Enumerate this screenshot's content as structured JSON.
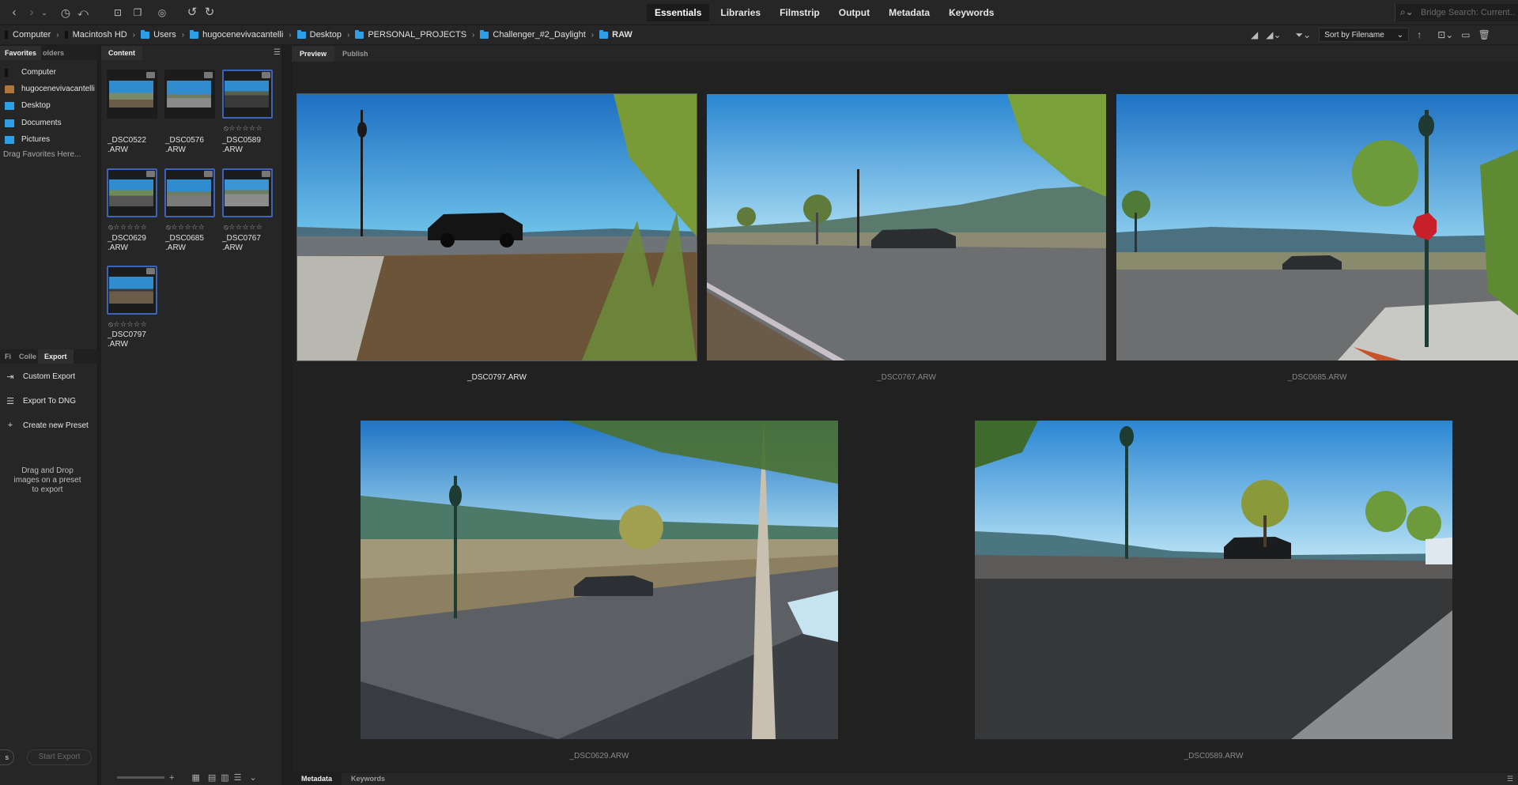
{
  "toolbar": {
    "workspaces": [
      "Essentials",
      "Libraries",
      "Filmstrip",
      "Output",
      "Metadata",
      "Keywords"
    ],
    "active_workspace": "Essentials",
    "search_placeholder": "Bridge Search: Current..."
  },
  "path": [
    "Computer",
    "Macintosh HD",
    "Users",
    "hugocenevivacantelli",
    "Desktop",
    "PERSONAL_PROJECTS",
    "Challenger_#2_Daylight",
    "RAW"
  ],
  "sort_label": "Sort by Filename",
  "left_panel": {
    "tabs": [
      "Favorites",
      "olders"
    ],
    "favorites": [
      {
        "label": "Computer",
        "icon": "drive-icon"
      },
      {
        "label": "hugocenevivacantelli",
        "icon": "home-icon"
      },
      {
        "label": "Desktop",
        "icon": "folder-icon"
      },
      {
        "label": "Documents",
        "icon": "folder-icon"
      },
      {
        "label": "Pictures",
        "icon": "folder-icon"
      }
    ],
    "drag_hint": "Drag Favorites Here...",
    "export_tabs": [
      "Fi",
      "Colle",
      "Export"
    ],
    "export_items": [
      {
        "label": "Custom Export",
        "icon": "export-icon"
      },
      {
        "label": "Export To DNG",
        "icon": "list-icon"
      },
      {
        "label": "Create new Preset",
        "icon": "plus-icon"
      }
    ],
    "drop_hint": "Drag and Drop images on a preset to export",
    "left_button": "s",
    "start_export": "Start Export"
  },
  "content_panel": {
    "tab": "Content",
    "thumbnails": [
      {
        "name": "_DSC0522",
        "ext": ".ARW",
        "rating": "",
        "selected": false
      },
      {
        "name": "_DSC0576",
        "ext": ".ARW",
        "rating": "",
        "selected": false
      },
      {
        "name": "_DSC0589",
        "ext": ".ARW",
        "rating": "⦸☆☆☆☆☆",
        "selected": true
      },
      {
        "name": "_DSC0629",
        "ext": ".ARW",
        "rating": "⦸☆☆☆☆☆",
        "selected": true
      },
      {
        "name": "_DSC0685",
        "ext": ".ARW",
        "rating": "⦸☆☆☆☆☆",
        "selected": true
      },
      {
        "name": "_DSC0767",
        "ext": ".ARW",
        "rating": "⦸☆☆☆☆☆",
        "selected": true
      },
      {
        "name": "_DSC0797",
        "ext": ".ARW",
        "rating": "⦸☆☆☆☆☆",
        "selected": true
      }
    ]
  },
  "preview": {
    "tabs": [
      "Preview",
      "Publish"
    ],
    "active_tab": "Preview",
    "images": [
      {
        "caption": "_DSC0797.ARW",
        "selected": true
      },
      {
        "caption": "_DSC0767.ARW",
        "selected": false
      },
      {
        "caption": "_DSC0685.ARW",
        "selected": false
      },
      {
        "caption": "_DSC0629.ARW",
        "selected": false
      },
      {
        "caption": "_DSC0589.ARW",
        "selected": false
      }
    ]
  },
  "bottom_tabs": [
    "Metadata",
    "Keywords"
  ],
  "colors": {
    "accent": "#3f63b7",
    "folder": "#2d9fe8",
    "panel": "#262626"
  }
}
